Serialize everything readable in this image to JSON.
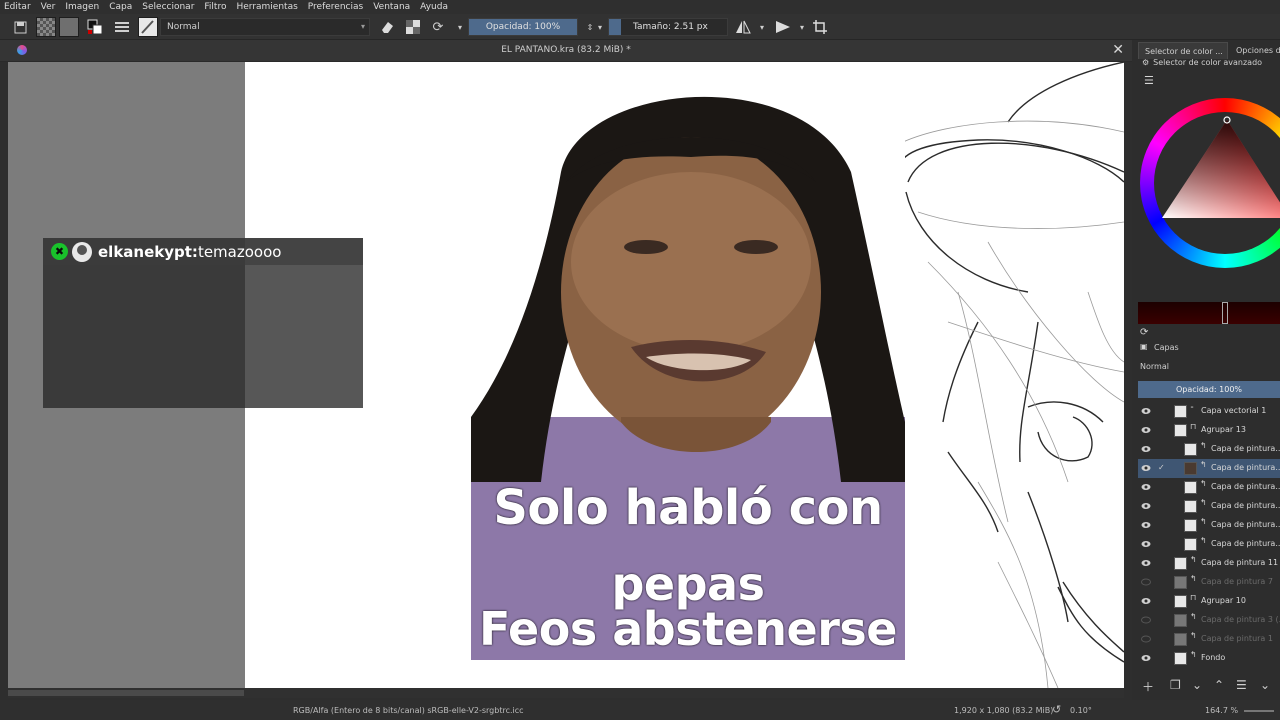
{
  "menu": [
    "Editar",
    "Ver",
    "Imagen",
    "Capa",
    "Seleccionar",
    "Filtro",
    "Herramientas",
    "Preferencias",
    "Ventana",
    "Ayuda"
  ],
  "toolbar": {
    "blend_mode": "Normal",
    "opacity_label": "Opacidad: 100%",
    "opacity_value": 1.0,
    "size_label": "Tamaño: 2.51 px",
    "icons": [
      "save-icon",
      "pattern-icon",
      "gradient-icon",
      "color-swap-icon",
      "brush-presets-icon",
      "brush-tip-icon",
      "eraser-icon",
      "alpha-lock-icon",
      "reload-preset-icon",
      "mirror-horizontal-icon",
      "mirror-vertical-icon",
      "wrap-around-icon"
    ]
  },
  "document": {
    "title": "EL PANTANO.kra (83.2 MiB) *"
  },
  "chat": {
    "badge": "✖",
    "username": "elkanekypt:",
    "message": " temazoooo"
  },
  "meme": {
    "line1": "Solo habló con",
    "line2": "pepas",
    "line3": "Feos abstenerse"
  },
  "status": {
    "color_space": "RGB/Alfa (Entero de 8 bits/canal)  sRGB-elle-V2-srgbtrc.icc",
    "image_size": "1,920 x 1,080 (83.2 MiB)",
    "rotation": "0.10°",
    "zoom": "164.7 %"
  },
  "dock": {
    "tab1": "Selector de color ...",
    "tab2": "Opciones de",
    "advanced_selector": "Selector de color avanzado",
    "layers_title": "Capas",
    "layers_blend": "Normal",
    "layers_opacity": "Opacidad:  100%",
    "layers": [
      {
        "name": "Capa vectorial 1",
        "type": "vector",
        "indent": 0,
        "visible": true,
        "selected": false
      },
      {
        "name": "Agrupar 13",
        "type": "group",
        "indent": 0,
        "visible": true,
        "selected": false
      },
      {
        "name": "Capa de pintura...",
        "type": "paint",
        "indent": 1,
        "visible": true,
        "selected": false
      },
      {
        "name": "Capa de pintura...",
        "type": "paint",
        "indent": 1,
        "visible": true,
        "selected": true
      },
      {
        "name": "Capa de pintura...",
        "type": "paint",
        "indent": 1,
        "visible": true,
        "selected": false
      },
      {
        "name": "Capa de pintura...",
        "type": "paint",
        "indent": 1,
        "visible": true,
        "selected": false
      },
      {
        "name": "Capa de pintura...",
        "type": "paint",
        "indent": 1,
        "visible": true,
        "selected": false
      },
      {
        "name": "Capa de pintura...",
        "type": "paint",
        "indent": 1,
        "visible": true,
        "selected": false
      },
      {
        "name": "Capa de pintura 11",
        "type": "paint",
        "indent": 0,
        "visible": true,
        "selected": false
      },
      {
        "name": "Capa de pintura 7",
        "type": "paint",
        "indent": 0,
        "visible": false,
        "selected": false
      },
      {
        "name": "Agrupar 10",
        "type": "group",
        "indent": 0,
        "visible": true,
        "selected": false
      },
      {
        "name": "Capa de pintura 3 (...",
        "type": "paint",
        "indent": 0,
        "visible": false,
        "selected": false
      },
      {
        "name": "Capa de pintura 1",
        "type": "paint",
        "indent": 0,
        "visible": false,
        "selected": false
      },
      {
        "name": "Fondo",
        "type": "paint",
        "indent": 0,
        "visible": true,
        "selected": false
      }
    ]
  },
  "colors": {
    "accent": "#4e6a8c",
    "chat_badge": "#19c22b",
    "shirt": "#8d78a8"
  }
}
